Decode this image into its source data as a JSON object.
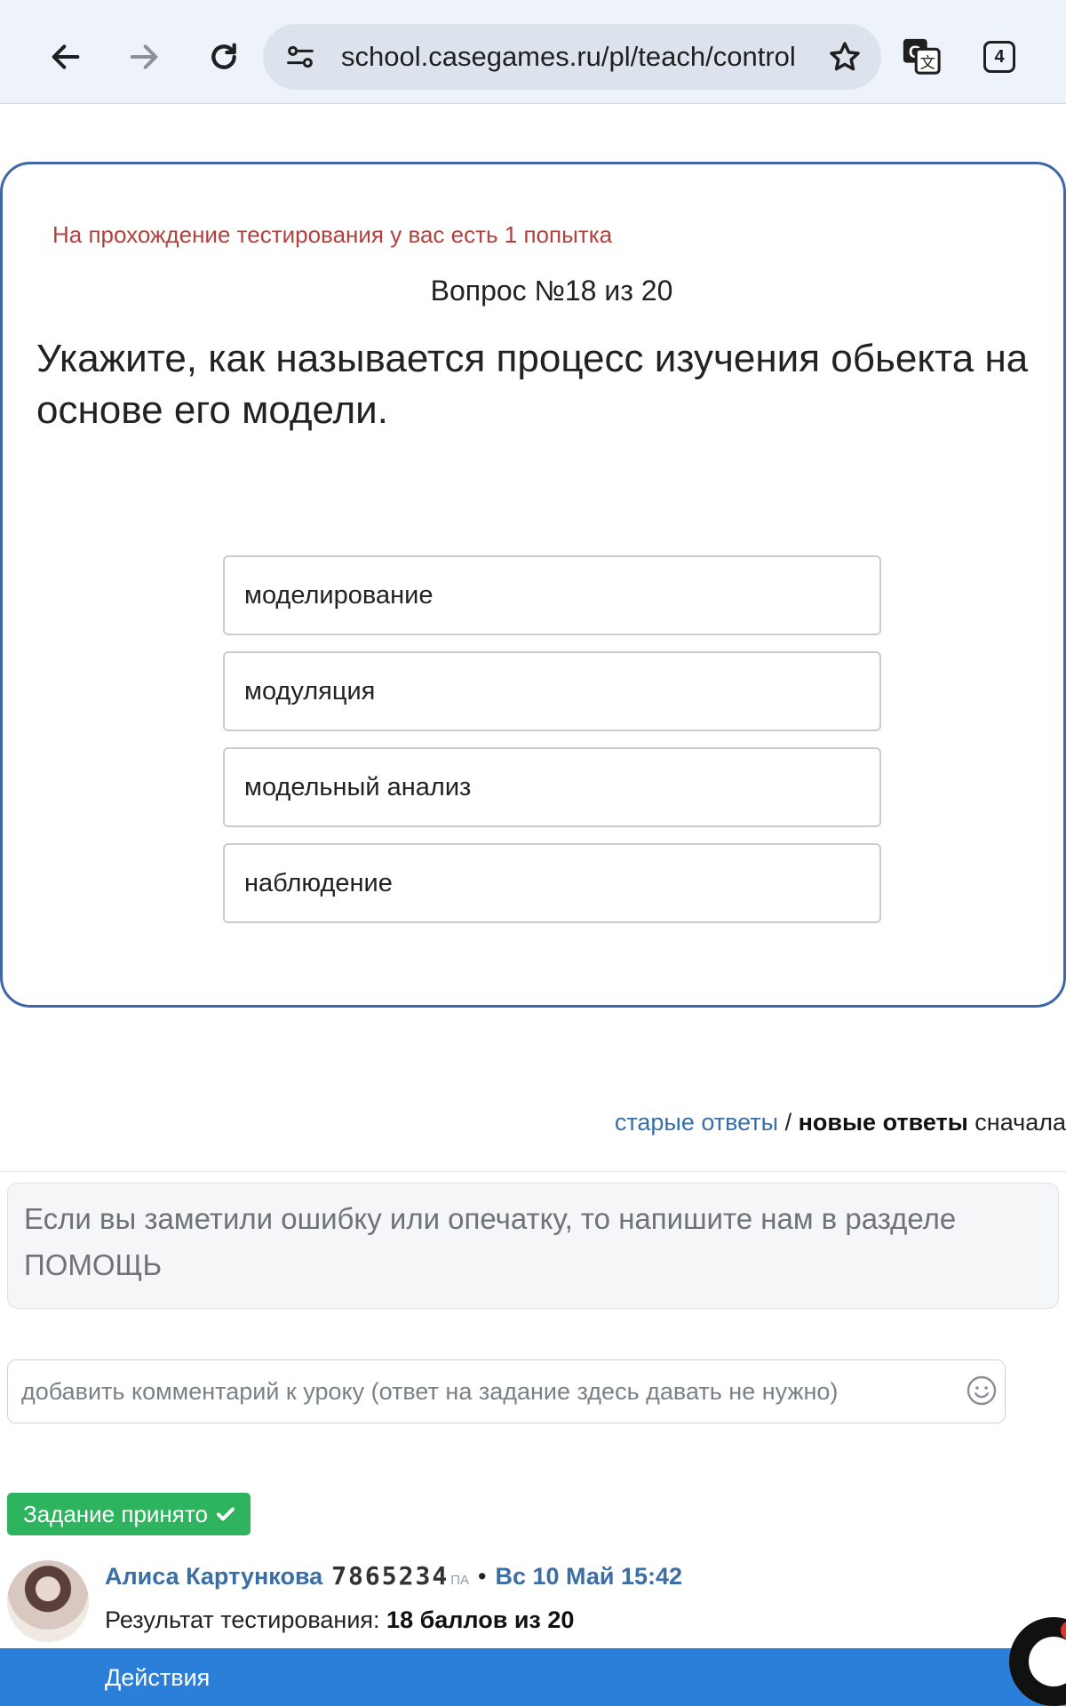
{
  "browser": {
    "url": "school.casegames.ru/pl/teach/control",
    "tab_count": "4",
    "icons": [
      "arrow-left-icon",
      "arrow-right-icon",
      "reload-icon",
      "site-settings-icon",
      "star-icon",
      "translate-icon"
    ]
  },
  "test": {
    "attempts_note": "На прохождение тестирования у вас есть 1 попытка",
    "question_number": "Вопрос №18 из 20",
    "question_text": "Укажите, как называется процесс изучения обьекта на основе его модели.",
    "options": [
      "моделирование",
      "модуляция",
      "модельный анализ",
      "наблюдение"
    ]
  },
  "comments": {
    "sort_old": "старые ответы",
    "sort_separator": " / ",
    "sort_new": "новые ответы",
    "sort_tail": " сначала",
    "notice": "Если вы заметили ошибку или опечатку, то напишите нам в разделе ПОМОЩЬ",
    "comment_placeholder": "добавить комментарий к уроку (ответ на задание здесь давать не нужно)",
    "accepted_label": "Задание принято",
    "author": "Алиса Картункова",
    "author_rating": "7865234",
    "author_rating_suffix": "ПА",
    "separator_dot": "•",
    "date": "Вс 10 Май 15:42",
    "result_label": "Результат тестирования:",
    "result_value": "18 баллов из 20",
    "actions_label": "Действия"
  },
  "colors": {
    "card_border": "#3e66a8",
    "attempts_text": "#b0413e",
    "link": "#3b6ea5",
    "accepted_bg": "#2eb45f",
    "actions_bar": "#2b7fd8"
  }
}
